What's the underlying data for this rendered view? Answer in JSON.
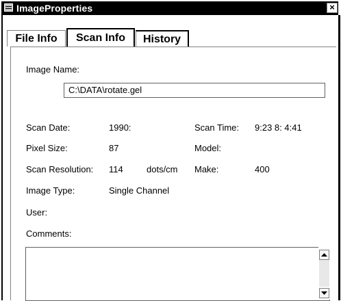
{
  "window": {
    "title": "ImageProperties",
    "close_glyph": "×"
  },
  "tabs": [
    {
      "label": "File Info"
    },
    {
      "label": "Scan Info"
    },
    {
      "label": "History"
    }
  ],
  "form": {
    "image_name_label": "Image Name:",
    "image_name_value": "C:\\DATA\\rotate.gel",
    "scan_date_label": "Scan Date:",
    "scan_date_value": "1990:",
    "scan_time_label": "Scan Time:",
    "scan_time_value": "9:23  8: 4:41",
    "pixel_size_label": "Pixel Size:",
    "pixel_size_value": "87",
    "model_label": "Model:",
    "model_value": "",
    "scan_resolution_label": "Scan Resolution:",
    "scan_resolution_value": "114",
    "scan_resolution_unit": "dots/cm",
    "make_label": "Make:",
    "make_value": "400",
    "image_type_label": "Image Type:",
    "image_type_value": "Single Channel",
    "user_label": "User:",
    "user_value": "",
    "comments_label": "Comments:",
    "comments_value": ""
  }
}
